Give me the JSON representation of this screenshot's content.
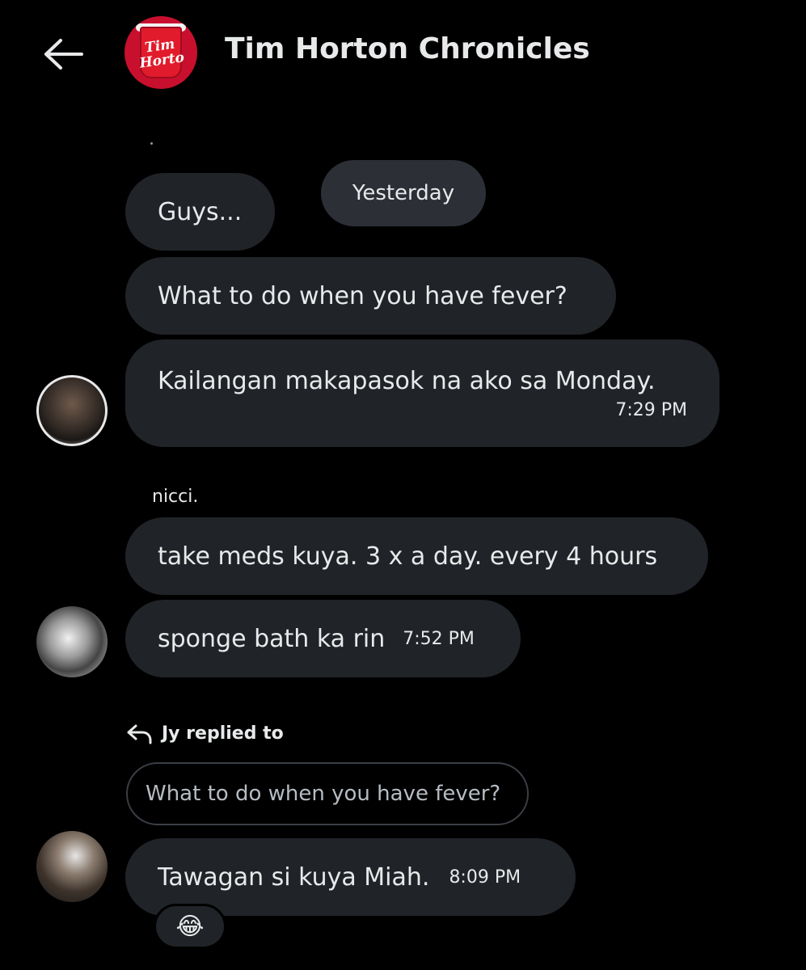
{
  "header": {
    "back_icon": "arrow-left-icon",
    "avatar_text": "Tim Horto",
    "title": "Tim Horton Chronicles"
  },
  "divider": {
    "label": "Yesterday"
  },
  "thread": {
    "group1": {
      "messages": [
        {
          "text": "Guys..."
        },
        {
          "text": "What to do when you have fever?"
        },
        {
          "text": "Kailangan makapasok na ako sa Monday.",
          "time": "7:29 PM"
        }
      ]
    },
    "group2": {
      "sender": "nicci.",
      "messages": [
        {
          "text": "take meds kuya. 3 x a day. every 4 hours"
        },
        {
          "text": "sponge bath ka rin",
          "time": "7:52 PM"
        }
      ]
    },
    "group3": {
      "reply_label": "Jy replied to",
      "quoted": "What to do when you have fever?",
      "message": {
        "text": "Tawagan si kuya Miah.",
        "time": "8:09 PM"
      },
      "reaction": "😂"
    }
  },
  "colors": {
    "background": "#000000",
    "bubble": "#202327",
    "text": "#e7e9ea",
    "brand_red": "#c8102e"
  }
}
